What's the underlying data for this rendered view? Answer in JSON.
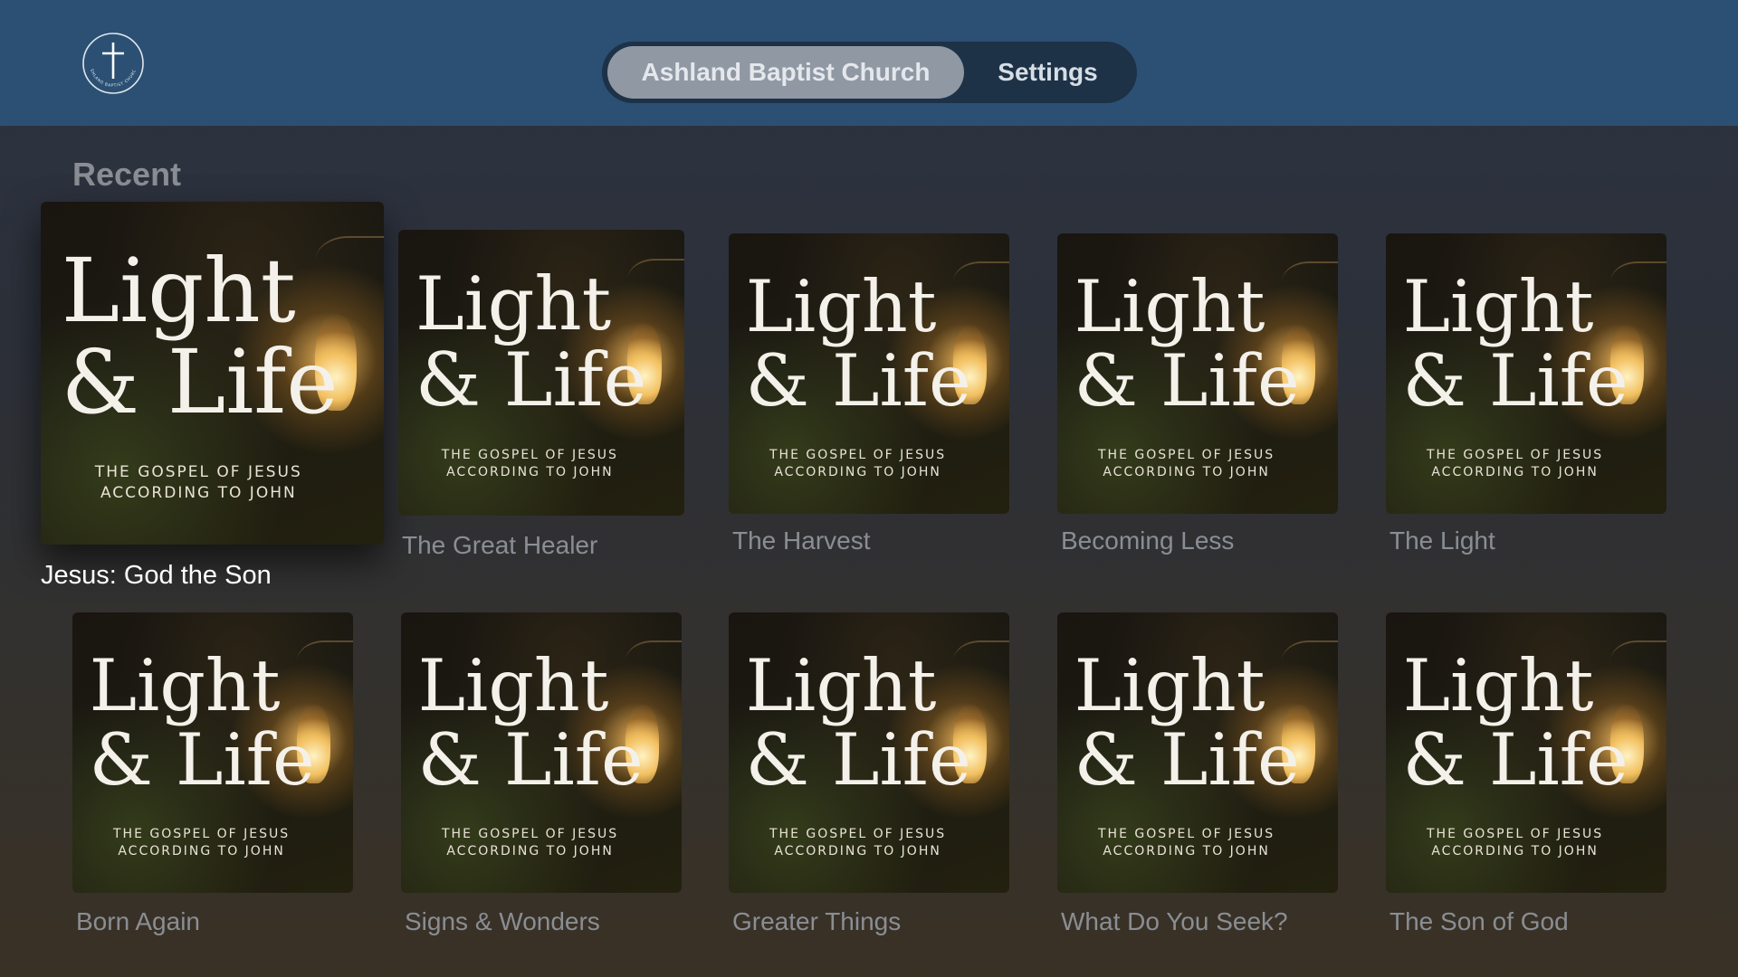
{
  "header": {
    "logo_icon": "cross-circle-logo",
    "logo_text": "ASHLAND BAPTIST CHURCH",
    "segments": [
      {
        "label": "Ashland Baptist Church",
        "selected": true
      },
      {
        "label": "Settings",
        "selected": false
      }
    ]
  },
  "recent": {
    "title": "Recent",
    "artwork": {
      "title": "Light\n& Life",
      "subtitle": "THE GOSPEL OF JESUS\nACCORDING TO JOHN"
    },
    "items": [
      {
        "label": "Jesus: God the Son",
        "focused": true
      },
      {
        "label": "The Great Healer"
      },
      {
        "label": "The Harvest"
      },
      {
        "label": "Becoming Less"
      },
      {
        "label": "The Light"
      },
      {
        "label": "Born Again"
      },
      {
        "label": "Signs & Wonders"
      },
      {
        "label": "Greater Things"
      },
      {
        "label": "What Do You Seek?"
      },
      {
        "label": "The Son of God"
      }
    ]
  },
  "colors": {
    "topbar": "#2c5073",
    "segmented_bg": "#1d3147",
    "segment_selected": "#8f98a3",
    "label_dim": "#8a8e94",
    "label_focused": "#ffffff"
  }
}
